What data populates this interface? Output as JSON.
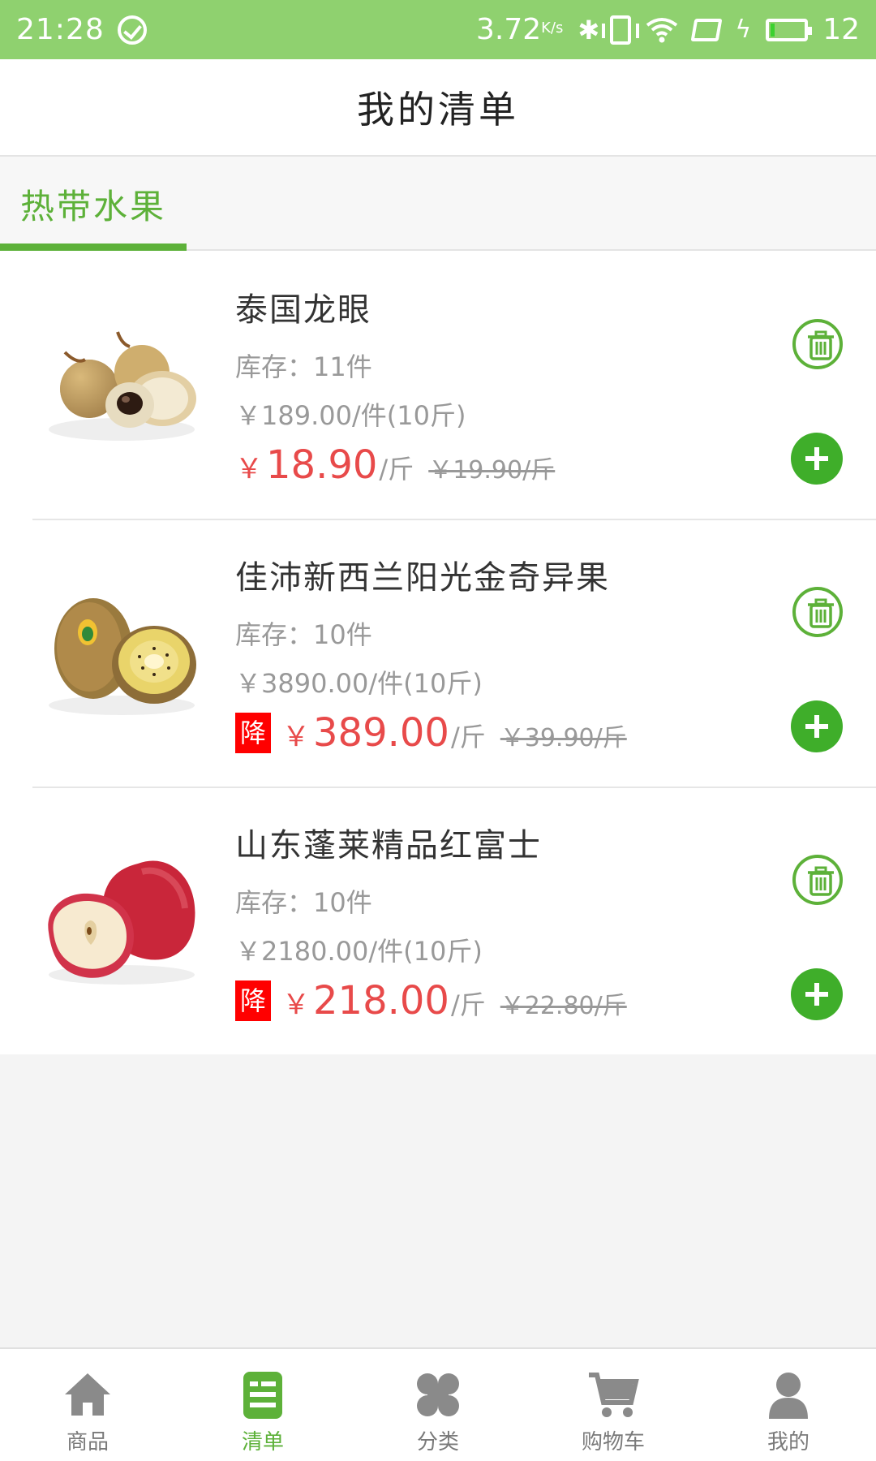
{
  "status_bar": {
    "time": "21:28",
    "net_speed": "3.72",
    "net_speed_unit": "K/s",
    "battery": "12"
  },
  "header": {
    "title": "我的清单"
  },
  "category_tabs": [
    {
      "label": "热带水果",
      "active": true
    }
  ],
  "items": [
    {
      "name": "泰国龙眼",
      "stock": "库存：11件",
      "unit_price": "￥189.00/件(10斤)",
      "price_symbol": "￥",
      "price": "18.90",
      "price_unit": "/斤",
      "original_price": "￥19.90/斤",
      "discount_badge": null,
      "image": "longan"
    },
    {
      "name": "佳沛新西兰阳光金奇异果",
      "stock": "库存：10件",
      "unit_price": "￥3890.00/件(10斤)",
      "price_symbol": "￥",
      "price": "389.00",
      "price_unit": "/斤",
      "original_price": "￥39.90/斤",
      "discount_badge": "降",
      "image": "kiwi"
    },
    {
      "name": "山东蓬莱精品红富士",
      "stock": "库存：10件",
      "unit_price": "￥2180.00/件(10斤)",
      "price_symbol": "￥",
      "price": "218.00",
      "price_unit": "/斤",
      "original_price": "￥22.80/斤",
      "discount_badge": "降",
      "image": "apple"
    }
  ],
  "bottom_nav": [
    {
      "label": "商品",
      "icon": "home-icon",
      "active": false
    },
    {
      "label": "清单",
      "icon": "list-icon",
      "active": true
    },
    {
      "label": "分类",
      "icon": "category-icon",
      "active": false
    },
    {
      "label": "购物车",
      "icon": "cart-icon",
      "active": false
    },
    {
      "label": "我的",
      "icon": "user-icon",
      "active": false
    }
  ],
  "colors": {
    "status_bar": "#8fd16f",
    "accent_green": "#5db139",
    "price_red": "#e84a4a",
    "badge_red": "#ff0000"
  }
}
